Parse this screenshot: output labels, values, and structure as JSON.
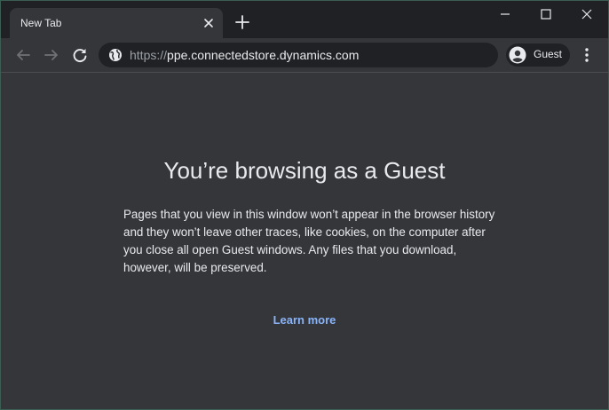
{
  "tab": {
    "title": "New Tab"
  },
  "toolbar": {
    "url_scheme": "https://",
    "url_host": "ppe.connectedstore.dynamics.com",
    "profile_label": "Guest"
  },
  "page": {
    "heading": "You’re browsing as a Guest",
    "description": "Pages that you view in this window won’t appear in the browser history and they won’t leave other traces, like cookies, on the computer after you close all open Guest windows. Any files that you download, however, will be preserved.",
    "learn_more": "Learn more"
  },
  "colors": {
    "frame": "#202124",
    "toolbar": "#35363a",
    "text": "#e8eaed",
    "muted": "#9aa0a6",
    "link": "#8ab4f8"
  },
  "icons": {
    "tab_close": "close-icon",
    "new_tab": "plus-icon",
    "minimize": "minimize-icon",
    "maximize": "maximize-icon",
    "close_window": "close-icon",
    "back": "arrow-left-icon",
    "forward": "arrow-right-icon",
    "reload": "reload-icon",
    "site_info": "globe-icon",
    "profile": "account-circle-icon",
    "menu": "more-vert-icon"
  }
}
